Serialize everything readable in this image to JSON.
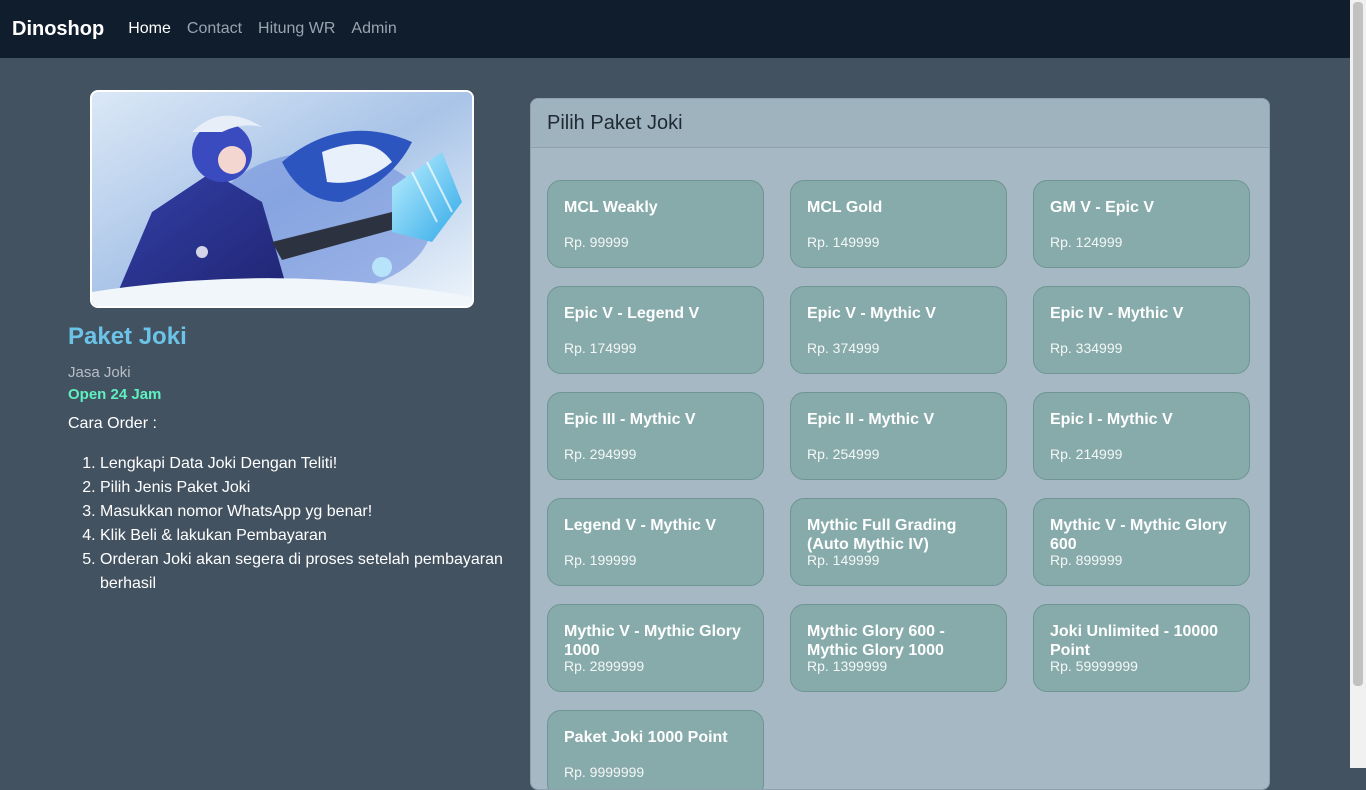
{
  "nav": {
    "brand": "Dinoshop",
    "links": [
      "Home",
      "Contact",
      "Hitung WR",
      "Admin"
    ]
  },
  "hero": {
    "icon": "game-hero-image"
  },
  "info": {
    "title": "Paket Joki",
    "subtitle": "Jasa Joki",
    "open": "Open 24 Jam",
    "order_heading": "Cara Order :",
    "steps": [
      "Lengkapi Data Joki Dengan Teliti!",
      "Pilih Jenis Paket Joki",
      "Masukkan nomor WhatsApp yg benar!",
      "Klik Beli & lakukan Pembayaran",
      "Orderan Joki akan segera di proses setelah pembayaran berhasil"
    ]
  },
  "panel": {
    "title": "Pilih Paket Joki",
    "packages": [
      {
        "name": "MCL Weakly",
        "price": "Rp. 99999"
      },
      {
        "name": "MCL Gold",
        "price": "Rp. 149999"
      },
      {
        "name": "GM V - Epic V",
        "price": "Rp. 124999"
      },
      {
        "name": "Epic V - Legend V",
        "price": "Rp. 174999"
      },
      {
        "name": "Epic V - Mythic V",
        "price": "Rp. 374999"
      },
      {
        "name": "Epic IV - Mythic V",
        "price": "Rp. 334999"
      },
      {
        "name": "Epic III - Mythic V",
        "price": "Rp. 294999"
      },
      {
        "name": "Epic II - Mythic V",
        "price": "Rp. 254999"
      },
      {
        "name": "Epic I - Mythic V",
        "price": "Rp. 214999"
      },
      {
        "name": "Legend V - Mythic V",
        "price": "Rp. 199999"
      },
      {
        "name": "Mythic Full Grading (Auto Mythic IV)",
        "price": "Rp. 149999"
      },
      {
        "name": "Mythic V - Mythic Glory 600",
        "price": "Rp. 899999"
      },
      {
        "name": "Mythic V - Mythic Glory 1000",
        "price": "Rp. 2899999"
      },
      {
        "name": "Mythic Glory 600 - Mythic Glory 1000",
        "price": "Rp. 1399999"
      },
      {
        "name": "Joki Unlimited - 10000 Point",
        "price": "Rp. 59999999"
      },
      {
        "name": "Paket Joki 1000 Point",
        "price": "Rp. 9999999"
      }
    ]
  },
  "colors": {
    "navbar": "#0f1d2c",
    "page_bg": "#435261",
    "title": "#6cc3e8",
    "open": "#5ef0c0",
    "card": "#87abaa"
  }
}
